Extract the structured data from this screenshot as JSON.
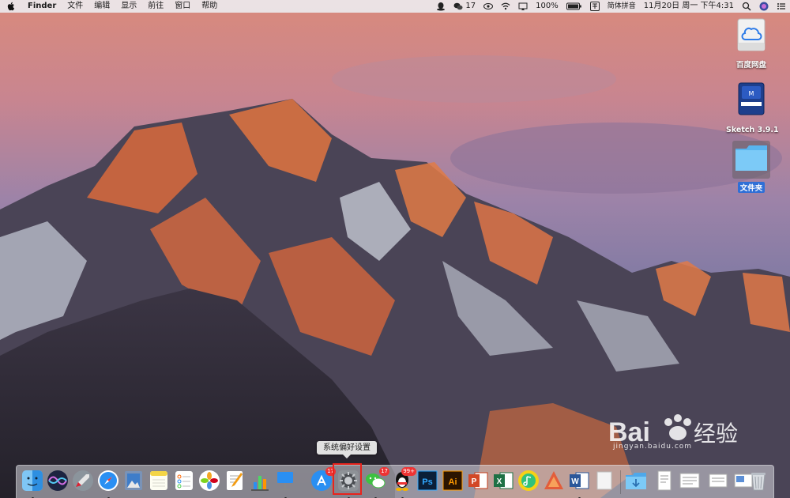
{
  "menubar": {
    "app_name": "Finder",
    "menus": [
      "文件",
      "编辑",
      "显示",
      "前往",
      "窗口",
      "帮助"
    ],
    "wechat_badge": "17",
    "battery": "100%",
    "input_method": "简体拼音",
    "datetime": "11月20日 周一 下午4:31"
  },
  "desktop": {
    "icons": [
      {
        "label": "百度网盘",
        "icon": "baidu-netdisk-drive-icon"
      },
      {
        "label": "Sketch 3.9.1",
        "icon": "disk-image-icon"
      },
      {
        "label": "文件夹",
        "icon": "folder-icon"
      }
    ]
  },
  "dock": {
    "tooltip": "系统偏好设置",
    "badges": {
      "appstore": "17",
      "wechat": "17",
      "qq": "99+"
    },
    "items": [
      "Finder",
      "Siri",
      "Launchpad",
      "Safari",
      "Preview",
      "Notes",
      "Reminders",
      "Photos",
      "Pages",
      "Numbers",
      "Keynote",
      "App Store",
      "System Preferences",
      "WeChat",
      "QQ",
      "Photoshop",
      "Illustrator",
      "PowerPoint",
      "Excel",
      "QQ Music",
      "Affinity",
      "Word",
      "Downloads",
      "Document",
      "Document",
      "Document",
      "Trash"
    ]
  },
  "watermark": {
    "text": "Bai",
    "cn": "经验",
    "url": "jingyan.baidu.com"
  },
  "colors": {
    "highlight": "#e8231c",
    "selection": "#2f6fd6"
  }
}
